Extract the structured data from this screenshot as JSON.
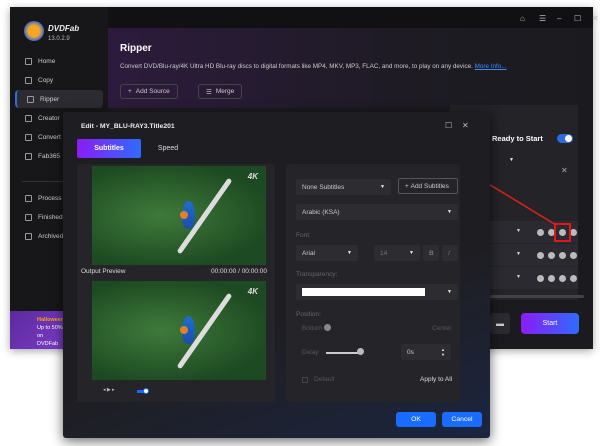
{
  "app": {
    "brand": "DVDFab",
    "version": "13.0.2.9"
  },
  "sidebar": {
    "items": [
      {
        "label": "Home"
      },
      {
        "label": "Copy"
      },
      {
        "label": "Ripper"
      },
      {
        "label": "Creator"
      },
      {
        "label": "Convert"
      },
      {
        "label": "Fab365"
      },
      {
        "label": "Process"
      },
      {
        "label": "Finished"
      },
      {
        "label": "Archived"
      }
    ],
    "promo": {
      "title": "Halloween",
      "line1": "Up to 50%",
      "line2": "on DVDFab"
    }
  },
  "header": {
    "title": "Ripper",
    "description": "Convert DVD/Blu-ray/4K Ultra HD Blu-ray discs to digital formats like MP4, MKV, MP3, FLAC, and more, to play on any device.",
    "more_info": "More Info...",
    "add_source": "Add Source",
    "merge": "Merge"
  },
  "panel": {
    "ready_label": "Ready to Start",
    "ready_on": true,
    "start": "Start"
  },
  "dialog": {
    "title": "Edit - MY_BLU-RAY3.Title201",
    "tabs": [
      {
        "label": "Subtitles",
        "active": true
      },
      {
        "label": "Speed",
        "active": false
      }
    ],
    "preview": {
      "badge": "4K",
      "output_label": "Output Preview",
      "time": "00:00:00 / 00:00:00"
    },
    "subtitles": {
      "subtitle_select": "None Subtitles",
      "add_subtitles": "Add Subtitles",
      "language": "Arabic (KSA)",
      "font_label": "Font:",
      "font": "Arial",
      "size": "14",
      "bold": "B",
      "italic": "I",
      "transparency_label": "Transparency:",
      "position_label": "Position:",
      "position_left": "Bottom",
      "position_right": "Center",
      "delay_label": "Delay",
      "delay_value": "0s",
      "default_label": "Default",
      "apply_all": "Apply to All"
    },
    "ok": "OK",
    "cancel": "Cancel"
  },
  "colors": {
    "accent": "#1a6cff",
    "gradient_start": "#8b1cf5",
    "highlight": "#e01818"
  }
}
